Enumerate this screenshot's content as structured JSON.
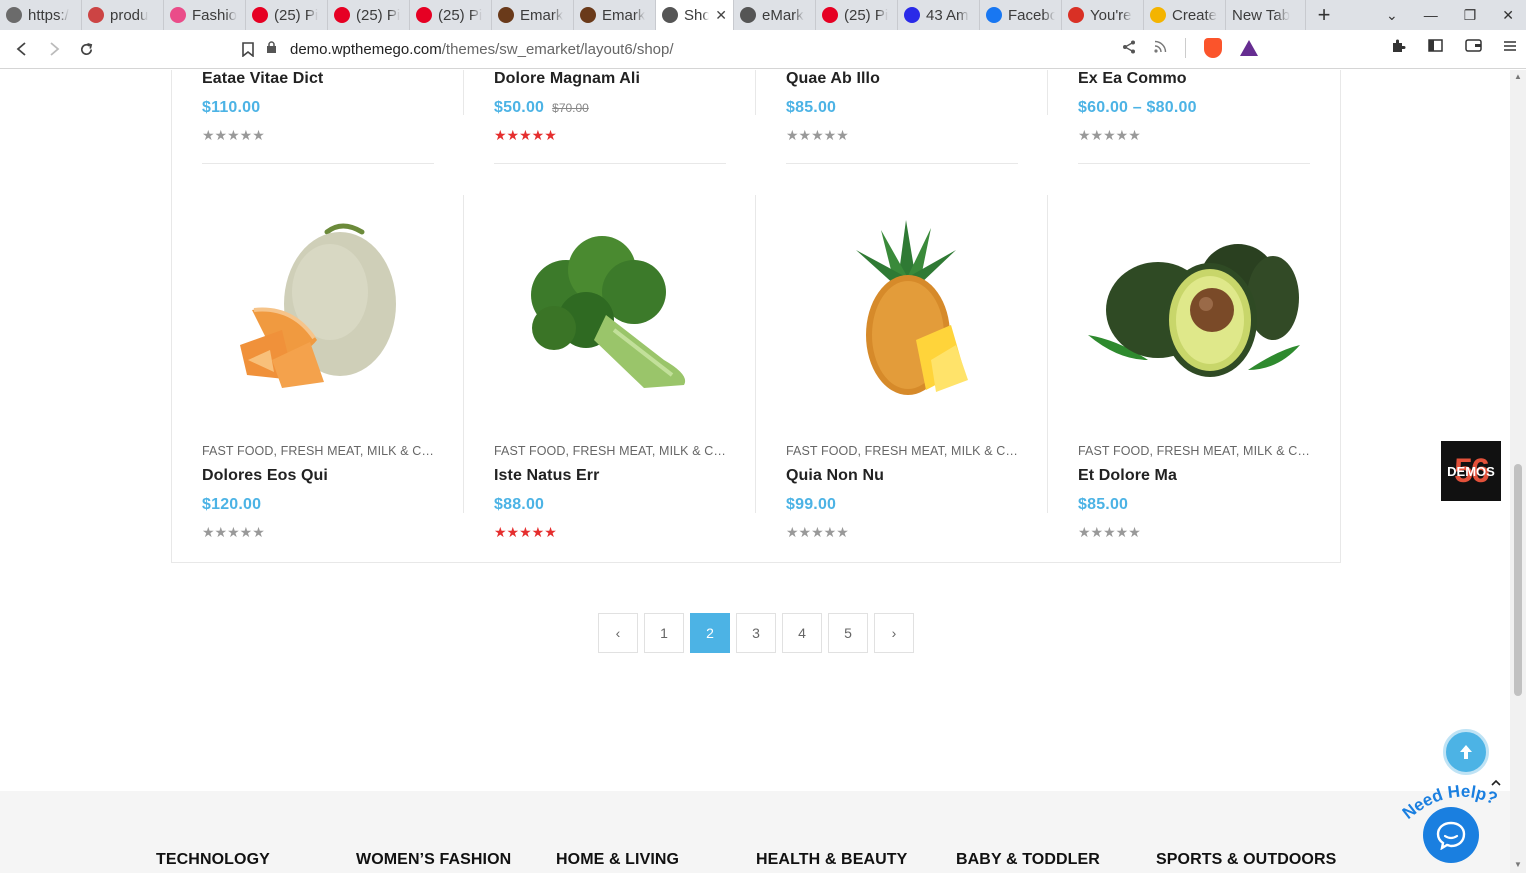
{
  "browser": {
    "tabs": [
      {
        "title": "https:/",
        "icon": "openai-icon",
        "color": "#6b6b6b"
      },
      {
        "title": "produ",
        "icon": "shield-icon",
        "color": "#c44"
      },
      {
        "title": "Fashio",
        "icon": "dribbble-icon",
        "color": "#ea4c89"
      },
      {
        "title": "(25) Pi",
        "icon": "pinterest-icon",
        "color": "#e60023"
      },
      {
        "title": "(25) Pi",
        "icon": "pinterest-icon",
        "color": "#e60023"
      },
      {
        "title": "(25) Pi",
        "icon": "pinterest-icon",
        "color": "#e60023"
      },
      {
        "title": "Emark",
        "icon": "emarket-icon",
        "color": "#6a3a1a"
      },
      {
        "title": "Emark",
        "icon": "emarket-icon",
        "color": "#6a3a1a"
      },
      {
        "title": "Sho",
        "icon": "wordpress-icon",
        "color": "#555",
        "active": true
      },
      {
        "title": "eMark",
        "icon": "wordpress-icon",
        "color": "#555"
      },
      {
        "title": "(25) Pi",
        "icon": "pinterest-icon",
        "color": "#e60023"
      },
      {
        "title": "43 Am",
        "icon": "circle-icon",
        "color": "#2a2ae8"
      },
      {
        "title": "Facebo",
        "icon": "facebook-icon",
        "color": "#1877f2"
      },
      {
        "title": "You're",
        "icon": "gmail-icon",
        "color": "#d93025"
      },
      {
        "title": "Create",
        "icon": "smiley-icon",
        "color": "#f4b400"
      },
      {
        "title": "New Tab",
        "icon": "",
        "color": ""
      }
    ],
    "url_host": "demo.wpthemego.com",
    "url_path": "/themes/sw_emarket/layout6/shop/"
  },
  "products_top": [
    {
      "name": "Eataе Vitae Dict",
      "price": "$110.00",
      "old_price": "",
      "rating": 0
    },
    {
      "name": "Dolore Magnam Ali",
      "price": "$50.00",
      "old_price": "$70.00",
      "rating": 5
    },
    {
      "name": "Quae Ab Illo",
      "price": "$85.00",
      "old_price": "",
      "rating": 0
    },
    {
      "name": "Ex Ea Commo",
      "price": "$60.00 – $80.00",
      "old_price": "",
      "rating": 0
    }
  ],
  "products": [
    {
      "categories": "FAST FOOD, FRESH MEAT, MILK & CREAM",
      "name": "Dolores Eos Qui",
      "price": "$120.00",
      "rating": 0,
      "image": "melon"
    },
    {
      "categories": "FAST FOOD, FRESH MEAT, MILK & CREAM",
      "name": "Iste Natus Err",
      "price": "$88.00",
      "rating": 5,
      "image": "broccoli"
    },
    {
      "categories": "FAST FOOD, FRESH MEAT, MILK & CREAM",
      "name": "Quia Non Nu",
      "price": "$99.00",
      "rating": 0,
      "image": "pineapple"
    },
    {
      "categories": "FAST FOOD, FRESH MEAT, MILK & CREAM",
      "name": "Et Dolore Ma",
      "price": "$85.00",
      "rating": 0,
      "image": "avocado"
    }
  ],
  "pagination": {
    "prev": "‹",
    "pages": [
      "1",
      "2",
      "3",
      "4",
      "5"
    ],
    "current": "2",
    "next": "›"
  },
  "footer": {
    "columns": [
      "TECHNOLOGY",
      "WOMEN’S FASHION",
      "HOME & LIVING",
      "HEALTH & BEAUTY",
      "BABY & TODDLER",
      "SPORTS & OUTDOORS"
    ]
  },
  "widgets": {
    "demos_count": "56",
    "demos_label": "DEMOS",
    "need_help": "Need Help?"
  },
  "colors": {
    "accent": "#4cb3e5",
    "star_active": "#e52e2e",
    "star_inactive": "#999999"
  }
}
